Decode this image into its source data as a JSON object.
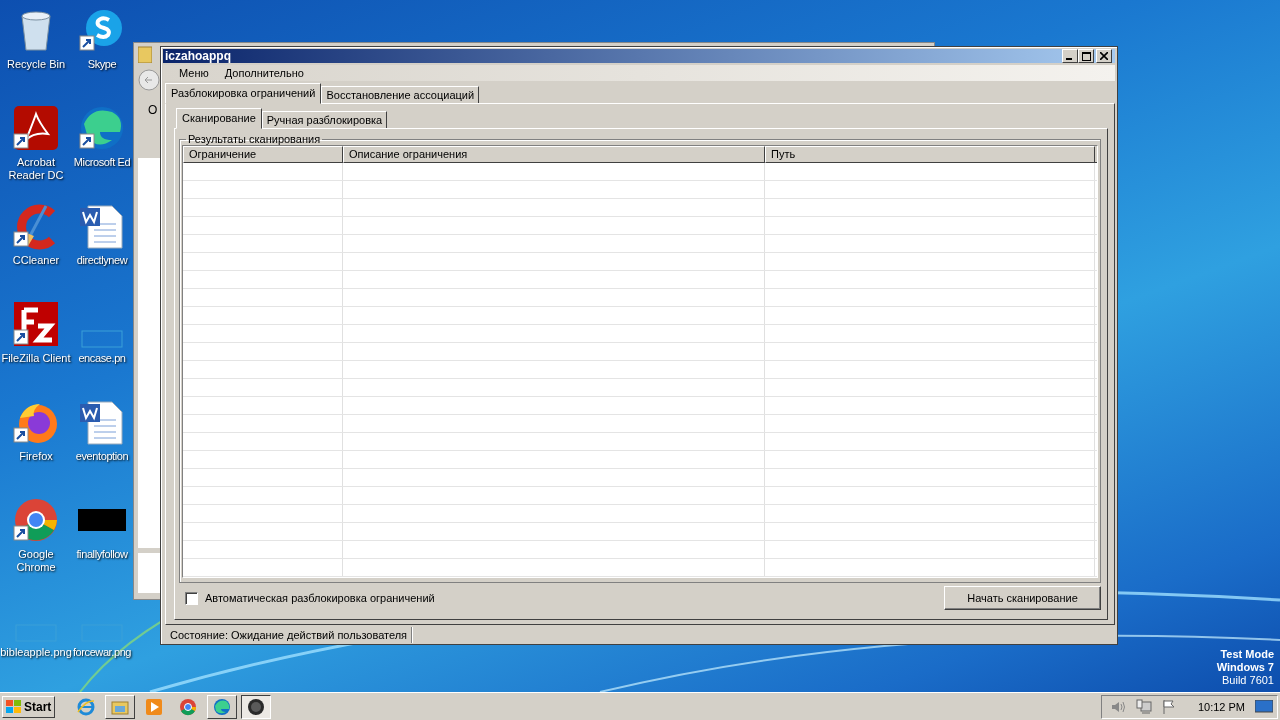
{
  "desktop_icons": [
    {
      "label": "Recycle Bin",
      "kind": "trash",
      "shortcut": false
    },
    {
      "label": "Skype",
      "kind": "skype",
      "shortcut": true
    },
    {
      "label": "Acrobat Reader DC",
      "kind": "pdf",
      "shortcut": true
    },
    {
      "label": "Microsoft Ed",
      "kind": "edge",
      "shortcut": true
    },
    {
      "label": "CCleaner",
      "kind": "ccleaner",
      "shortcut": true
    },
    {
      "label": "directlynew",
      "kind": "document",
      "shortcut": false
    },
    {
      "label": "FileZilla Client",
      "kind": "filezilla",
      "shortcut": true
    },
    {
      "label": "encase.pn",
      "kind": "blank",
      "shortcut": false
    },
    {
      "label": "Firefox",
      "kind": "firefox",
      "shortcut": true
    },
    {
      "label": "eventoption",
      "kind": "document",
      "shortcut": false
    },
    {
      "label": "Google Chrome",
      "kind": "chrome",
      "shortcut": true
    },
    {
      "label": "finallyfollow",
      "kind": "black",
      "shortcut": false
    },
    {
      "label": "bibleapple.png",
      "kind": "blank",
      "shortcut": false
    },
    {
      "label": "forcewar.png",
      "kind": "blank",
      "shortcut": false
    }
  ],
  "background_window": {
    "text": "O"
  },
  "window": {
    "title": "iczahoappq",
    "menu": [
      "Меню",
      "Дополнительно"
    ],
    "tabs": [
      {
        "label": "Разблокировка ограничений",
        "selected": true
      },
      {
        "label": "Восстановление ассоциаций",
        "selected": false
      }
    ],
    "subtabs": [
      {
        "label": "Сканирование",
        "selected": true
      },
      {
        "label": "Ручная разблокировка",
        "selected": false
      }
    ],
    "group_title": "Результаты сканирования",
    "table": {
      "columns": [
        "Ограничение",
        "Описание ограничения",
        "Путь"
      ]
    },
    "auto_unlock": {
      "label": "Автоматическая разблокировка ограничений",
      "checked": false
    },
    "scan_button": "Начать сканирование",
    "status_bar": "Состояние: Ожидание действий пользователя"
  },
  "os_notice": [
    "Test Mode",
    "Windows 7",
    "Build 7601"
  ],
  "taskbar": {
    "start": "Start",
    "apps": [
      {
        "kind": "ie",
        "running": false,
        "selected": false
      },
      {
        "kind": "folder",
        "running": true,
        "selected": false
      },
      {
        "kind": "media",
        "running": false,
        "selected": false
      },
      {
        "kind": "chrome",
        "running": false,
        "selected": false
      },
      {
        "kind": "edge",
        "running": true,
        "selected": false
      },
      {
        "kind": "app",
        "running": true,
        "selected": true
      }
    ],
    "clock": "10:12 PM"
  }
}
